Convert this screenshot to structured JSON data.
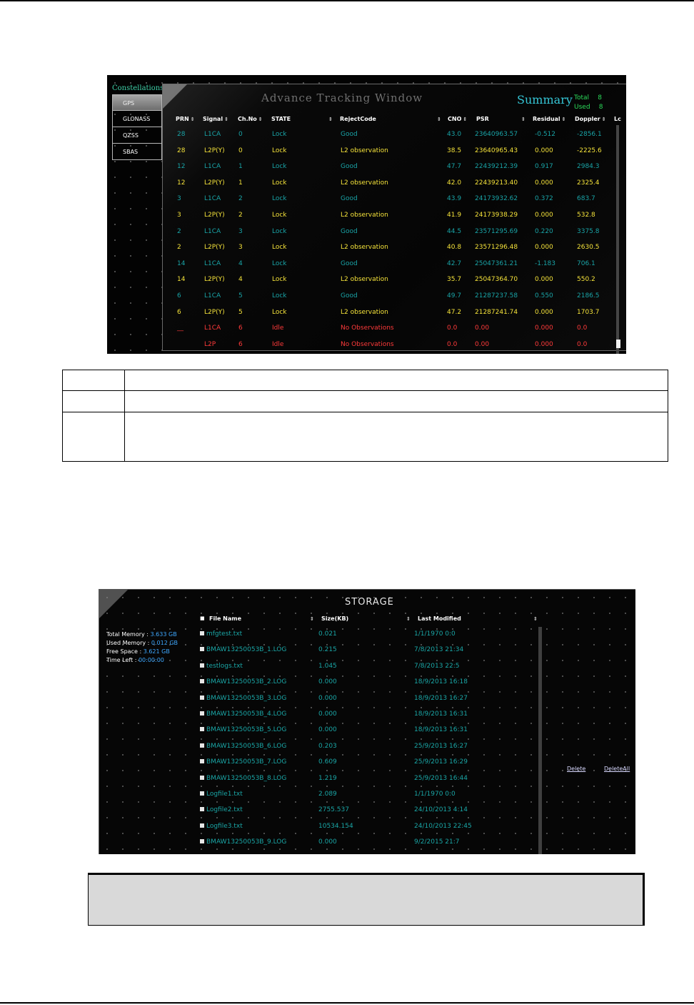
{
  "tracking": {
    "title": "Advance Tracking Window",
    "summary": {
      "label": "Summary",
      "total_label": "Total",
      "total": "8",
      "used_label": "Used",
      "used": "8"
    },
    "constellations_label": "Constellations",
    "constellations": [
      "GPS",
      "GLONASS",
      "QZSS",
      "SBAS"
    ],
    "columns": [
      "PRN",
      "Signal",
      "Ch.No",
      "STATE",
      "RejectCode",
      "CNO",
      "PSR",
      "Residual",
      "Doppler",
      "Lc"
    ],
    "rows": [
      {
        "prn": "28",
        "signal": "L1CA",
        "ch": "0",
        "state": "Lock",
        "reject": "Good",
        "cno": "43.0",
        "psr": "23640963.57",
        "residual": "-0.512",
        "doppler": "-2856.1",
        "tone": "cyan"
      },
      {
        "prn": "28",
        "signal": "L2P(Y)",
        "ch": "0",
        "state": "Lock",
        "reject": "L2 observation",
        "cno": "38.5",
        "psr": "23640965.43",
        "residual": "0.000",
        "doppler": "-2225.6",
        "tone": "yellow"
      },
      {
        "prn": "12",
        "signal": "L1CA",
        "ch": "1",
        "state": "Lock",
        "reject": "Good",
        "cno": "47.7",
        "psr": "22439212.39",
        "residual": "0.917",
        "doppler": "2984.3",
        "tone": "cyan"
      },
      {
        "prn": "12",
        "signal": "L2P(Y)",
        "ch": "1",
        "state": "Lock",
        "reject": "L2 observation",
        "cno": "42.0",
        "psr": "22439213.40",
        "residual": "0.000",
        "doppler": "2325.4",
        "tone": "yellow"
      },
      {
        "prn": "3",
        "signal": "L1CA",
        "ch": "2",
        "state": "Lock",
        "reject": "Good",
        "cno": "43.9",
        "psr": "24173932.62",
        "residual": "0.372",
        "doppler": "683.7",
        "tone": "cyan"
      },
      {
        "prn": "3",
        "signal": "L2P(Y)",
        "ch": "2",
        "state": "Lock",
        "reject": "L2 observation",
        "cno": "41.9",
        "psr": "24173938.29",
        "residual": "0.000",
        "doppler": "532.8",
        "tone": "yellow"
      },
      {
        "prn": "2",
        "signal": "L1CA",
        "ch": "3",
        "state": "Lock",
        "reject": "Good",
        "cno": "44.5",
        "psr": "23571295.69",
        "residual": "0.220",
        "doppler": "3375.8",
        "tone": "cyan"
      },
      {
        "prn": "2",
        "signal": "L2P(Y)",
        "ch": "3",
        "state": "Lock",
        "reject": "L2 observation",
        "cno": "40.8",
        "psr": "23571296.48",
        "residual": "0.000",
        "doppler": "2630.5",
        "tone": "yellow"
      },
      {
        "prn": "14",
        "signal": "L1CA",
        "ch": "4",
        "state": "Lock",
        "reject": "Good",
        "cno": "42.7",
        "psr": "25047361.21",
        "residual": "-1.183",
        "doppler": "706.1",
        "tone": "cyan"
      },
      {
        "prn": "14",
        "signal": "L2P(Y)",
        "ch": "4",
        "state": "Lock",
        "reject": "L2 observation",
        "cno": "35.7",
        "psr": "25047364.70",
        "residual": "0.000",
        "doppler": "550.2",
        "tone": "yellow"
      },
      {
        "prn": "6",
        "signal": "L1CA",
        "ch": "5",
        "state": "Lock",
        "reject": "Good",
        "cno": "49.7",
        "psr": "21287237.58",
        "residual": "0.550",
        "doppler": "2186.5",
        "tone": "cyan"
      },
      {
        "prn": "6",
        "signal": "L2P(Y)",
        "ch": "5",
        "state": "Lock",
        "reject": "L2 observation",
        "cno": "47.2",
        "psr": "21287241.74",
        "residual": "0.000",
        "doppler": "1703.7",
        "tone": "yellow"
      },
      {
        "prn": "__",
        "signal": "L1CA",
        "ch": "6",
        "state": "Idle",
        "reject": "No Observations",
        "cno": "0.0",
        "psr": "0.00",
        "residual": "0.000",
        "doppler": "0.0",
        "tone": "red"
      },
      {
        "prn": "",
        "signal": "L2P",
        "ch": "6",
        "state": "Idle",
        "reject": "No Observations",
        "cno": "0.0",
        "psr": "0.00",
        "residual": "0.000",
        "doppler": "0.0",
        "tone": "red"
      }
    ]
  },
  "storage": {
    "title": "STORAGE",
    "memory": [
      {
        "label": "Total Memory : ",
        "value": "3.633 GB"
      },
      {
        "label": "Used Memory : ",
        "value": "0.012 GB"
      },
      {
        "label": "Free Space : ",
        "value": "3.621 GB"
      },
      {
        "label": "Time Left : ",
        "value": "00:00:00"
      }
    ],
    "columns": [
      "File Name",
      "Size(KB)",
      "Last Modified"
    ],
    "files": [
      {
        "name": "mfgtest.txt",
        "size": "0.021",
        "modified": "1/1/1970 0:0"
      },
      {
        "name": "BMAW13250053B_1.LOG",
        "size": "0.215",
        "modified": "7/8/2013 21:34"
      },
      {
        "name": "testlogs.txt",
        "size": "1.045",
        "modified": "7/8/2013 22:5"
      },
      {
        "name": "BMAW13250053B_2.LOG",
        "size": "0.000",
        "modified": "18/9/2013 16:18"
      },
      {
        "name": "BMAW13250053B_3.LOG",
        "size": "0.000",
        "modified": "18/9/2013 16:27"
      },
      {
        "name": "BMAW13250053B_4.LOG",
        "size": "0.000",
        "modified": "18/9/2013 16:31"
      },
      {
        "name": "BMAW13250053B_5.LOG",
        "size": "0.000",
        "modified": "18/9/2013 16:31"
      },
      {
        "name": "BMAW13250053B_6.LOG",
        "size": "0.203",
        "modified": "25/9/2013 16:27"
      },
      {
        "name": "BMAW13250053B_7.LOG",
        "size": "0.609",
        "modified": "25/9/2013 16:29"
      },
      {
        "name": "BMAW13250053B_8.LOG",
        "size": "1.219",
        "modified": "25/9/2013 16:44"
      },
      {
        "name": "Logfile1.txt",
        "size": "2.089",
        "modified": "1/1/1970 0:0"
      },
      {
        "name": "Logfile2.txt",
        "size": "2755.537",
        "modified": "24/10/2013 4:14"
      },
      {
        "name": "Logfile3.txt",
        "size": "10534.154",
        "modified": "24/10/2013 22:45"
      },
      {
        "name": "BMAW13250053B_9.LOG",
        "size": "0.000",
        "modified": "9/2/2015 21:7"
      }
    ],
    "delete_label": "Delete",
    "delete_all_label": "DeleteAll"
  }
}
